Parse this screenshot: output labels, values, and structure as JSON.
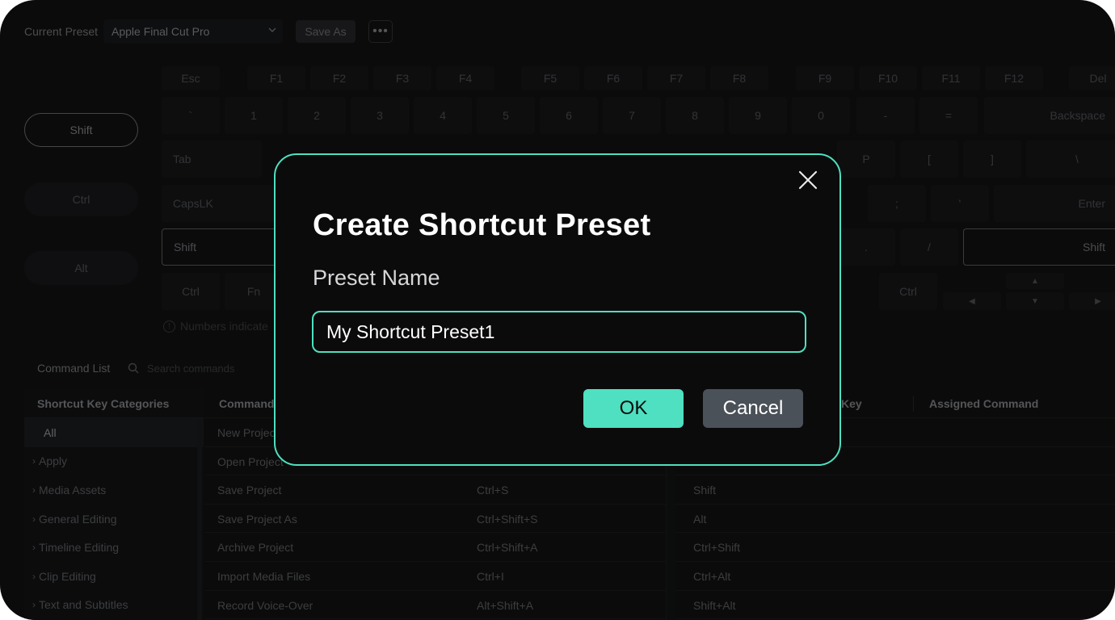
{
  "topbar": {
    "current_preset_label": "Current Preset",
    "preset_value": "Apple Final Cut Pro",
    "save_as_label": "Save As",
    "more_label": "•••"
  },
  "modifiers": [
    "Shift",
    "Ctrl",
    "Alt"
  ],
  "keyboard": {
    "function_row": [
      "Esc",
      "F1",
      "F2",
      "F3",
      "F4",
      "F5",
      "F6",
      "F7",
      "F8",
      "F9",
      "F10",
      "F11",
      "F12",
      "Del"
    ],
    "number_row": [
      "`",
      "1",
      "2",
      "3",
      "4",
      "5",
      "6",
      "7",
      "8",
      "9",
      "0",
      "-",
      "=",
      "Backspace"
    ],
    "row3_left": "Tab",
    "row3_right": [
      "P",
      "[",
      "]",
      "\\"
    ],
    "row4_left": "CapsLK",
    "row4_right": [
      ";",
      "'",
      "Enter"
    ],
    "row5_left": "Shift",
    "row5_right": [
      ".",
      "/",
      "Shift"
    ],
    "row6": [
      "Ctrl",
      "Fn",
      "Ctrl"
    ],
    "arrows": [
      "▲",
      "◀",
      "▼",
      "▶"
    ],
    "hint": "Numbers indicate"
  },
  "command_list": {
    "label": "Command List",
    "search_placeholder": "Search commands",
    "categories_header": "Shortcut Key Categories",
    "categories": [
      "All",
      "Apply",
      "Media Assets",
      "General Editing",
      "Timeline Editing",
      "Clip Editing",
      "Text and Subtitles"
    ],
    "col_command": "Command",
    "col_key": "Key",
    "col_assigned": "Assigned Command",
    "rows": [
      {
        "command": "New Project",
        "shortcut": "",
        "key": ""
      },
      {
        "command": "Open Project",
        "shortcut": "",
        "key": ""
      },
      {
        "command": "Save Project",
        "shortcut": "Ctrl+S",
        "key": "Shift"
      },
      {
        "command": "Save Project As",
        "shortcut": "Ctrl+Shift+S",
        "key": "Alt"
      },
      {
        "command": "Archive Project",
        "shortcut": "Ctrl+Shift+A",
        "key": "Ctrl+Shift"
      },
      {
        "command": "Import Media Files",
        "shortcut": "Ctrl+I",
        "key": "Ctrl+Alt"
      },
      {
        "command": "Record Voice-Over",
        "shortcut": "Alt+Shift+A",
        "key": "Shift+Alt"
      }
    ]
  },
  "dialog": {
    "title": "Create Shortcut Preset",
    "field_label": "Preset Name",
    "field_value": "My Shortcut Preset1",
    "ok_label": "OK",
    "cancel_label": "Cancel",
    "accent_color": "#4ee0c0"
  }
}
